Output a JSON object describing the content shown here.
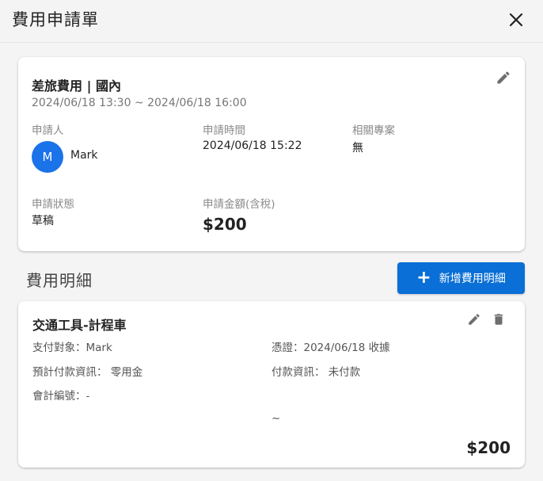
{
  "header": {
    "title": "費用申請單"
  },
  "request": {
    "title": "差旅費用 | 國內",
    "period": "2024/06/18 13:30 ~ 2024/06/18 16:00",
    "applicant_label": "申請人",
    "applicant_initial": "M",
    "applicant_name": "Mark",
    "time_label": "申請時間",
    "time_value": "2024/06/18 15:22",
    "project_label": "相關專案",
    "project_value": "無",
    "status_label": "申請狀態",
    "status_value": "草稿",
    "amount_label": "申請金額(含稅)",
    "amount_value": "$200"
  },
  "details": {
    "section_title": "費用明細",
    "add_button_label": "新增費用明細",
    "items": [
      {
        "title": "交通工具-計程車",
        "payee": "支付對象：Mark",
        "voucher": "憑證：2024/06/18  收據",
        "prepay": "預計付款資訊：  零用金",
        "payment": "付款資訊：  未付款",
        "account": "會計編號：-",
        "range": "~",
        "amount": "$200"
      }
    ]
  },
  "icons": {
    "close": "close-icon",
    "edit": "pencil-icon",
    "delete": "trash-icon",
    "add": "plus-icon"
  },
  "colors": {
    "accent": "#0a6fd6",
    "avatar": "#1a73e8"
  }
}
